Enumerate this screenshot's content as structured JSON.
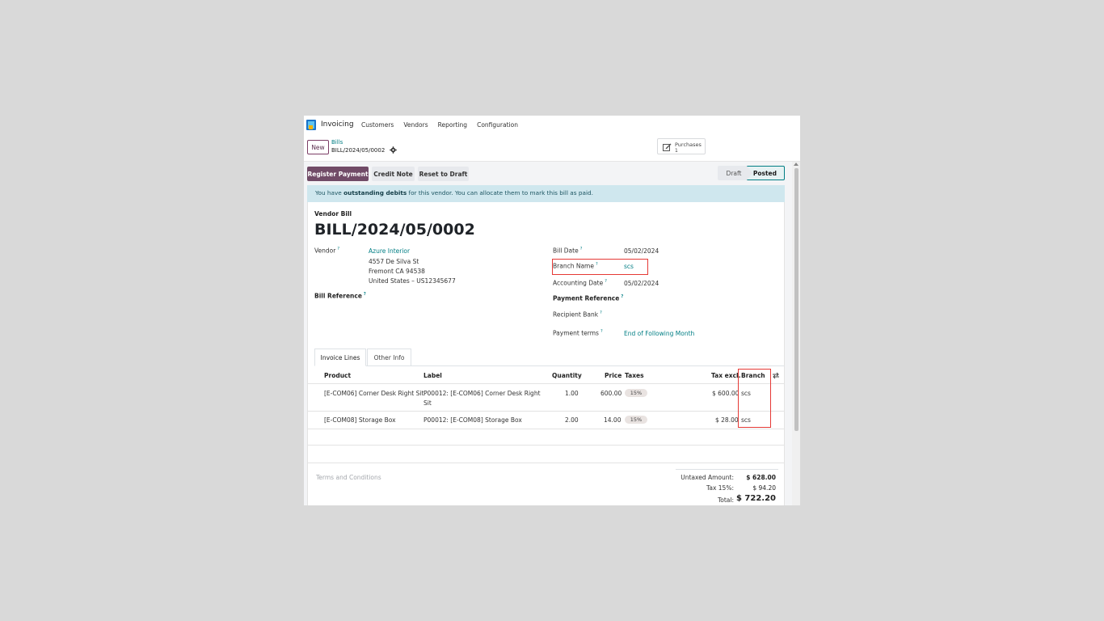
{
  "navbar": {
    "app_name": "Invoicing",
    "menu": [
      "Customers",
      "Vendors",
      "Reporting",
      "Configuration"
    ]
  },
  "control": {
    "new_label": "New",
    "breadcrumb_parent": "Bills",
    "breadcrumb_current": "BILL/2024/05/0002",
    "smart_button_label": "Purchases",
    "smart_button_count": "1"
  },
  "status_bar": {
    "buttons": [
      "Register Payment",
      "Credit Note",
      "Reset to Draft"
    ],
    "stages": [
      "Draft",
      "Posted"
    ],
    "active_stage": "Posted"
  },
  "alert": {
    "prefix": "You have ",
    "bold": "outstanding debits",
    "suffix": " for this vendor. You can allocate them to mark this bill as paid."
  },
  "form": {
    "doc_type": "Vendor Bill",
    "title": "BILL/2024/05/0002",
    "vendor_label": "Vendor",
    "vendor_name": "Azure Interior",
    "vendor_address": [
      "4557 De Silva St",
      "Fremont CA 94538",
      "United States – US12345677"
    ],
    "bill_reference_label": "Bill Reference",
    "bill_date_label": "Bill Date",
    "bill_date": "05/02/2024",
    "branch_name_label": "Branch Name",
    "branch_name": "scs",
    "accounting_date_label": "Accounting Date",
    "accounting_date": "05/02/2024",
    "payment_reference_label": "Payment Reference",
    "recipient_bank_label": "Recipient Bank",
    "payment_terms_label": "Payment terms",
    "payment_terms": "End of Following Month",
    "help_mark": "?"
  },
  "tabs": [
    "Invoice Lines",
    "Other Info"
  ],
  "lines": {
    "headers": [
      "Product",
      "Label",
      "Quantity",
      "Price",
      "Taxes",
      "Tax excl.",
      "Branch"
    ],
    "rows": [
      {
        "product": "[E-COM06] Corner Desk Right Sit",
        "label1": "P00012: [E-COM06] Corner Desk Right",
        "label2": "Sit",
        "quantity": "1.00",
        "price": "600.00",
        "tax": "15%",
        "subtotal": "$ 600.00",
        "branch": "scs"
      },
      {
        "product": "[E-COM08] Storage Box",
        "label1": "P00012: [E-COM08] Storage Box",
        "label2": "",
        "quantity": "2.00",
        "price": "14.00",
        "tax": "15%",
        "subtotal": "$ 28.00",
        "branch": "scs"
      }
    ]
  },
  "footer": {
    "terms_placeholder": "Terms and Conditions",
    "untaxed_label": "Untaxed Amount:",
    "untaxed_value": "$ 628.00",
    "tax_label": "Tax 15%:",
    "tax_value": "$ 94.20",
    "total_label": "Total:",
    "total_value": "$ 722.20"
  },
  "colors": {
    "primary": "#714b67",
    "link": "#017e84",
    "highlight": "#e53935",
    "alert_bg": "#cfe7ee"
  }
}
